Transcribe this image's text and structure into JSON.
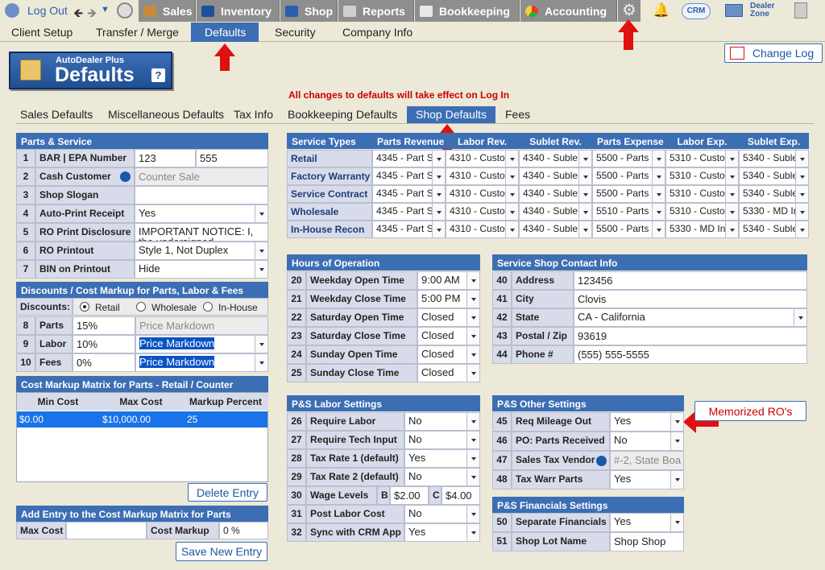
{
  "topnav": {
    "logout": "Log Out",
    "sales": "Sales",
    "inventory": "Inventory",
    "shop": "Shop",
    "reports": "Reports",
    "bookkeeping": "Bookkeeping",
    "accounting": "Accounting",
    "crm": "CRM",
    "dealer_zone_1": "Dealer",
    "dealer_zone_2": "Zone"
  },
  "menu": {
    "client_setup": "Client Setup",
    "transfer_merge": "Transfer / Merge",
    "defaults": "Defaults",
    "security": "Security",
    "company_info": "Company Info"
  },
  "logo": {
    "small": "AutoDealer Plus",
    "big": "Defaults",
    "help": "?"
  },
  "change_log": "Change Log",
  "notice": "All changes to defaults will take effect on Log In",
  "subtabs": {
    "sales": "Sales Defaults",
    "misc": "Miscellaneous Defaults",
    "tax": "Tax Info",
    "bookkeeping": "Bookkeeping Defaults",
    "shop": "Shop Defaults",
    "fees": "Fees"
  },
  "parts_service": {
    "title": "Parts & Service",
    "rows": [
      {
        "n": "1",
        "label": "BAR | EPA Number",
        "v1": "123",
        "v2": "555"
      },
      {
        "n": "2",
        "label": "Cash Customer",
        "value": "Counter Sale"
      },
      {
        "n": "3",
        "label": "Shop Slogan",
        "value": ""
      },
      {
        "n": "4",
        "label": "Auto-Print Receipt",
        "value": "Yes"
      },
      {
        "n": "5",
        "label": "RO Print Disclosure",
        "value": "IMPORTANT NOTICE: I, the undersigned"
      },
      {
        "n": "6",
        "label": "RO Printout",
        "value": "Style 1, Not Duplex"
      },
      {
        "n": "7",
        "label": "BIN on Printout",
        "value": "Hide"
      }
    ]
  },
  "discounts": {
    "title": "Discounts / Cost Markup for Parts, Labor & Fees",
    "label": "Discounts:",
    "opt_retail": "Retail",
    "opt_wholesale": "Wholesale",
    "opt_inhouse": "In-House",
    "rows": [
      {
        "n": "8",
        "label": "Parts",
        "pct": "15%",
        "mode": "Price Markdown"
      },
      {
        "n": "9",
        "label": "Labor",
        "pct": "10%",
        "mode": "Price Markdown"
      },
      {
        "n": "10",
        "label": "Fees",
        "pct": "0%",
        "mode": "Price Markdown"
      }
    ]
  },
  "matrix": {
    "title": "Cost Markup Matrix for Parts - Retail / Counter",
    "headers": [
      "Min Cost",
      "Max Cost",
      "Markup Percent"
    ],
    "row": [
      "$0.00",
      "$10,000.00",
      "25"
    ],
    "delete": "Delete Entry"
  },
  "add_entry": {
    "title": "Add Entry to the Cost Markup Matrix for Parts",
    "max_cost": "Max Cost",
    "cost_markup": "Cost Markup",
    "markup_value": "0 %",
    "save": "Save New Entry"
  },
  "service_types": {
    "headers": [
      "Service Types",
      "Parts Revenue",
      "Labor Rev.",
      "Sublet Rev.",
      "Parts Expense",
      "Labor Exp.",
      "Sublet Exp."
    ],
    "rows": [
      [
        "Retail",
        "4345 - Part S",
        "4310 - Custo",
        "4340 - Suble",
        "5500 - Parts",
        "5310 - Custo",
        "5340 - Suble"
      ],
      [
        "Factory Warranty",
        "4345 - Part S",
        "4310 - Custo",
        "4340 - Suble",
        "5500 - Parts",
        "5310 - Custo",
        "5340 - Suble"
      ],
      [
        "Service Contract",
        "4345 - Part S",
        "4310 - Custo",
        "4340 - Suble",
        "5500 - Parts",
        "5310 - Custo",
        "5340 - Suble"
      ],
      [
        "Wholesale",
        "4345 - Part S",
        "4310 - Custo",
        "4340 - Suble",
        "5510 - Parts",
        "5310 - Custo",
        "5330 - MD In"
      ],
      [
        "In-House Recon",
        "4345 - Part S",
        "4310 - Custo",
        "4340 - Suble",
        "5500 - Parts",
        "5330 - MD In",
        "5340 - Suble"
      ]
    ]
  },
  "hours": {
    "title": "Hours of Operation",
    "rows": [
      {
        "n": "20",
        "label": "Weekday Open Time",
        "value": "9:00 AM"
      },
      {
        "n": "21",
        "label": "Weekday Close Time",
        "value": "5:00 PM"
      },
      {
        "n": "22",
        "label": "Saturday Open Time",
        "value": "Closed"
      },
      {
        "n": "23",
        "label": "Saturday Close Time",
        "value": "Closed"
      },
      {
        "n": "24",
        "label": "Sunday Open Time",
        "value": "Closed"
      },
      {
        "n": "25",
        "label": "Sunday Close Time",
        "value": "Closed"
      }
    ]
  },
  "contact": {
    "title": "Service Shop Contact Info",
    "rows": [
      {
        "n": "40",
        "label": "Address",
        "value": "123456"
      },
      {
        "n": "41",
        "label": "City",
        "value": "Clovis"
      },
      {
        "n": "42",
        "label": "State",
        "value": "CA - California"
      },
      {
        "n": "43",
        "label": "Postal / Zip",
        "value": "93619"
      },
      {
        "n": "44",
        "label": "Phone #",
        "value": "(555) 555-5555"
      }
    ]
  },
  "labor": {
    "title": "P&S Labor Settings",
    "rows": [
      {
        "n": "26",
        "label": "Require Labor",
        "value": "No"
      },
      {
        "n": "27",
        "label": "Require Tech Input",
        "value": "No"
      },
      {
        "n": "28",
        "label": "Tax Rate 1 (default)",
        "value": "Yes"
      },
      {
        "n": "29",
        "label": "Tax Rate 2 (default)",
        "value": "No"
      },
      {
        "n": "30",
        "label": "Wage Levels",
        "b": "B",
        "bval": "$2.00",
        "c": "C",
        "cval": "$4.00"
      },
      {
        "n": "31",
        "label": "Post Labor Cost",
        "value": "No"
      },
      {
        "n": "32",
        "label": "Sync with CRM App",
        "value": "Yes"
      }
    ]
  },
  "other": {
    "title": "P&S Other Settings",
    "rows": [
      {
        "n": "45",
        "label": "Req Mileage Out",
        "value": "Yes"
      },
      {
        "n": "46",
        "label": "PO: Parts Received",
        "value": "No"
      },
      {
        "n": "47",
        "label": "Sales Tax Vendor",
        "value": "#-2, State Boa"
      },
      {
        "n": "48",
        "label": "Tax Warr Parts",
        "value": "Yes"
      }
    ]
  },
  "memorized": "Memorized RO's",
  "financials": {
    "title": "P&S Financials Settings",
    "rows": [
      {
        "n": "50",
        "label": "Separate Financials",
        "value": "Yes"
      },
      {
        "n": "51",
        "label": "Shop Lot Name",
        "value": "Shop Shop"
      }
    ]
  },
  "colors": {
    "header_blue": "#3c6eb4",
    "arrow_red": "#e01010",
    "label_bg": "#d8dcea",
    "bg": "#ece9d8"
  }
}
